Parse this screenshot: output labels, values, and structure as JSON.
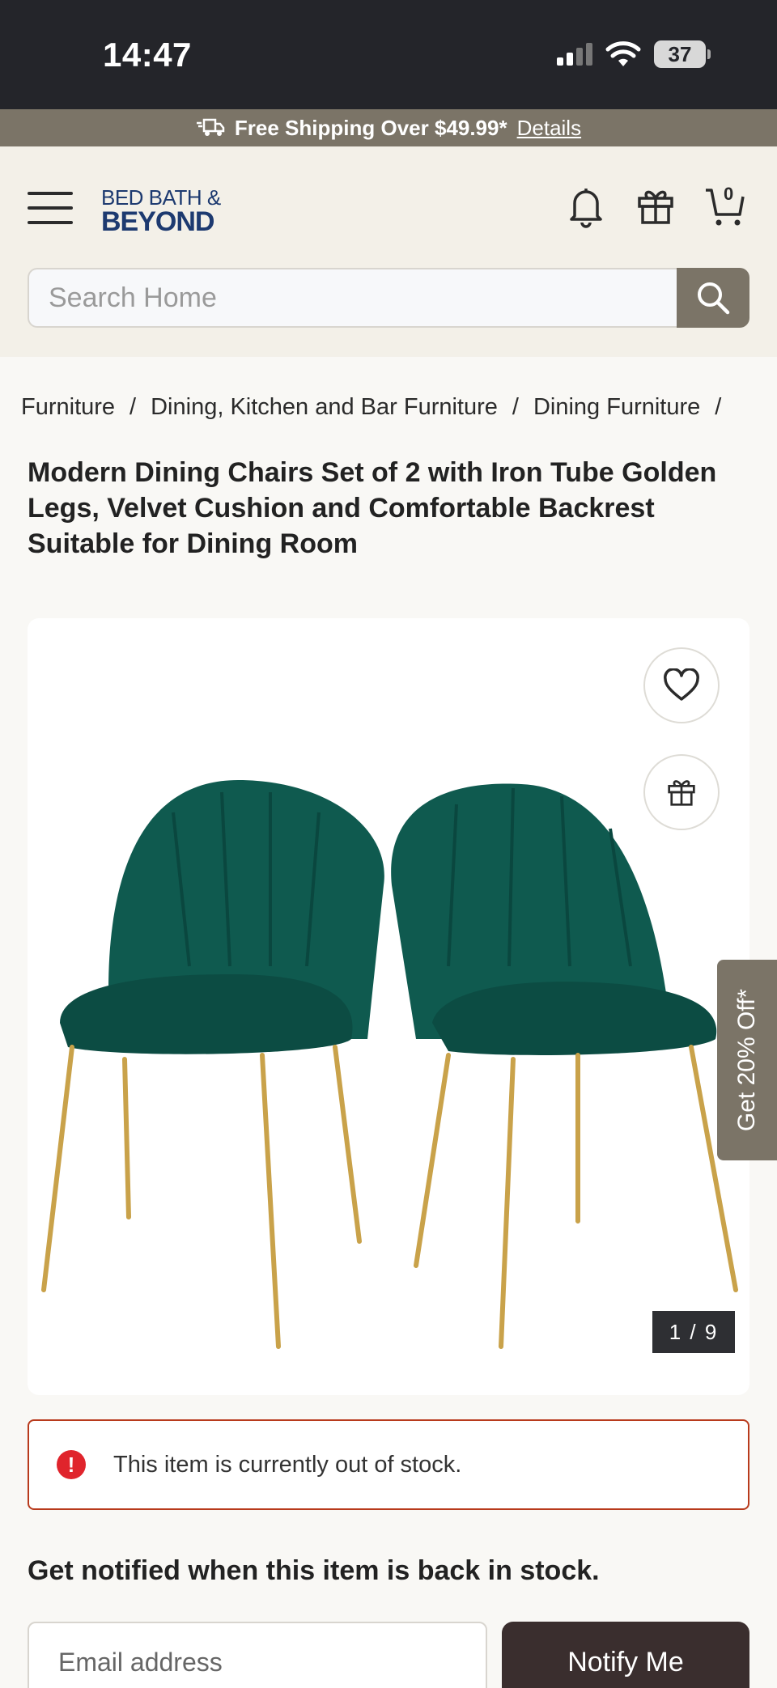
{
  "status_bar": {
    "time": "14:47",
    "battery": "37"
  },
  "banner": {
    "text": "Free Shipping Over $49.99*",
    "link": "Details"
  },
  "header": {
    "logo_line1": "BED BATH &",
    "logo_line2": "BEYOND",
    "cart_count": "0",
    "search_placeholder": "Search Home"
  },
  "breadcrumb": {
    "items": [
      "Furniture",
      "Dining, Kitchen and Bar Furniture",
      "Dining Furniture"
    ],
    "separator": "/"
  },
  "product": {
    "title": "Modern Dining Chairs Set of 2 with Iron Tube Golden Legs, Velvet Cushion and Comfortable Backrest Suitable for Dining Room",
    "image_counter": "1 / 9",
    "chair_color": "#0f5a4f",
    "leg_color": "#c9a24a"
  },
  "promo_tab": "Get 20% Off*",
  "stock": {
    "message": "This item is currently out of stock.",
    "notify_heading": "Get notified when this item is back in stock.",
    "email_placeholder": "Email address",
    "notify_button": "Notify Me"
  },
  "colors": {
    "accent": "#7b7467",
    "dark": "#24252a",
    "error": "#b83a1c"
  }
}
